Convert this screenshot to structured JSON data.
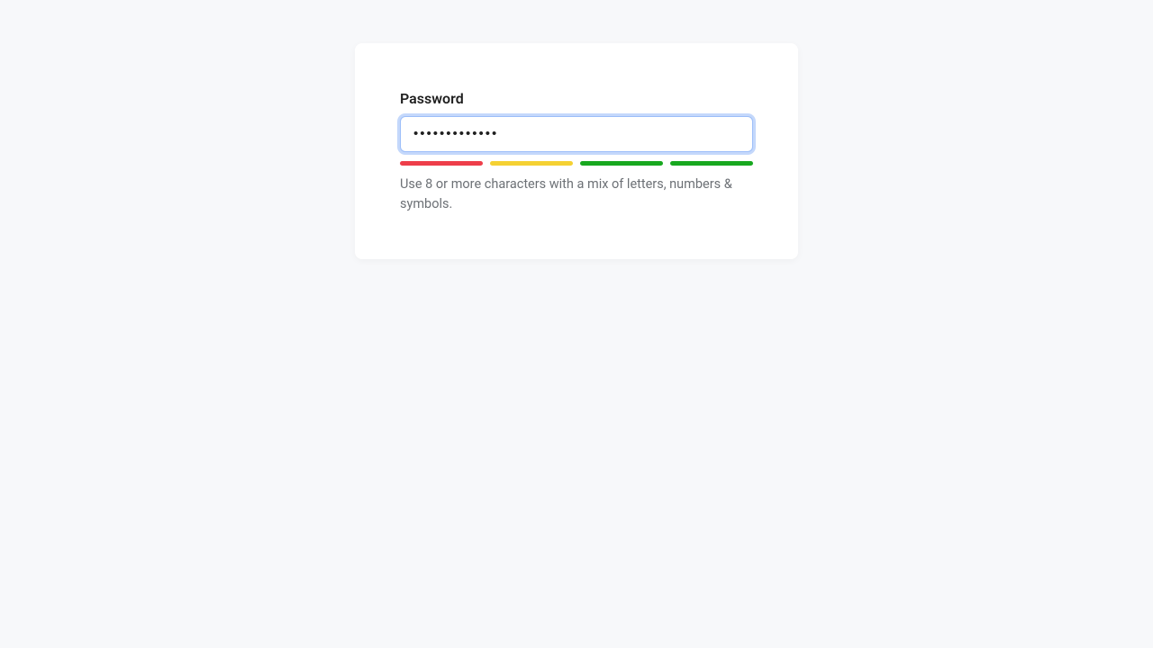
{
  "password": {
    "label": "Password",
    "value": "•••••••••••••",
    "helpText": "Use 8 or more characters with a mix of letters, numbers & symbols.",
    "strength": {
      "bars": [
        {
          "level": "red"
        },
        {
          "level": "yellow"
        },
        {
          "level": "green"
        },
        {
          "level": "green"
        }
      ]
    }
  },
  "colors": {
    "pageBg": "#f7f8fa",
    "cardBg": "#ffffff",
    "labelText": "#1f1f1f",
    "helpText": "#6d7176",
    "focusRing": "#9cbef9",
    "barRed": "#ee3e4a",
    "barYellow": "#f5d133",
    "barGreen": "#18a81f"
  }
}
